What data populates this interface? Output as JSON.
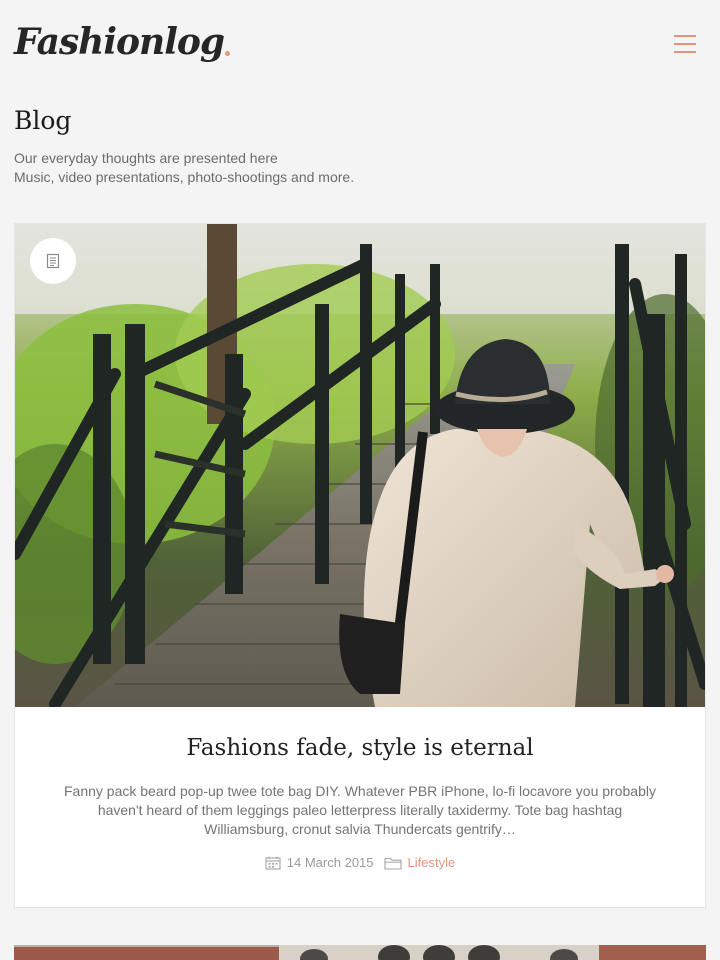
{
  "header": {
    "logo": "Fashionlog",
    "menu_icon": "hamburger-icon",
    "accent_color": "#e9957e"
  },
  "intro": {
    "title": "Blog",
    "lines": [
      "Our everyday thoughts are presented here",
      "Music, video presentations, photo-shootings and more."
    ]
  },
  "post": {
    "format_icon": "document-icon",
    "title": "Fashions fade, style is eternal",
    "excerpt": "Fanny pack beard pop-up twee tote bag DIY. Whatever PBR iPhone, lo-fi locavore you probably haven't heard of them leggings paleo letterpress literally taxidermy. Tote bag hashtag Williamsburg, cronut salvia Thundercats gentrify…",
    "date_icon": "calendar-icon",
    "date": "14 March 2015",
    "category_icon": "folder-icon",
    "category": "Lifestyle"
  }
}
